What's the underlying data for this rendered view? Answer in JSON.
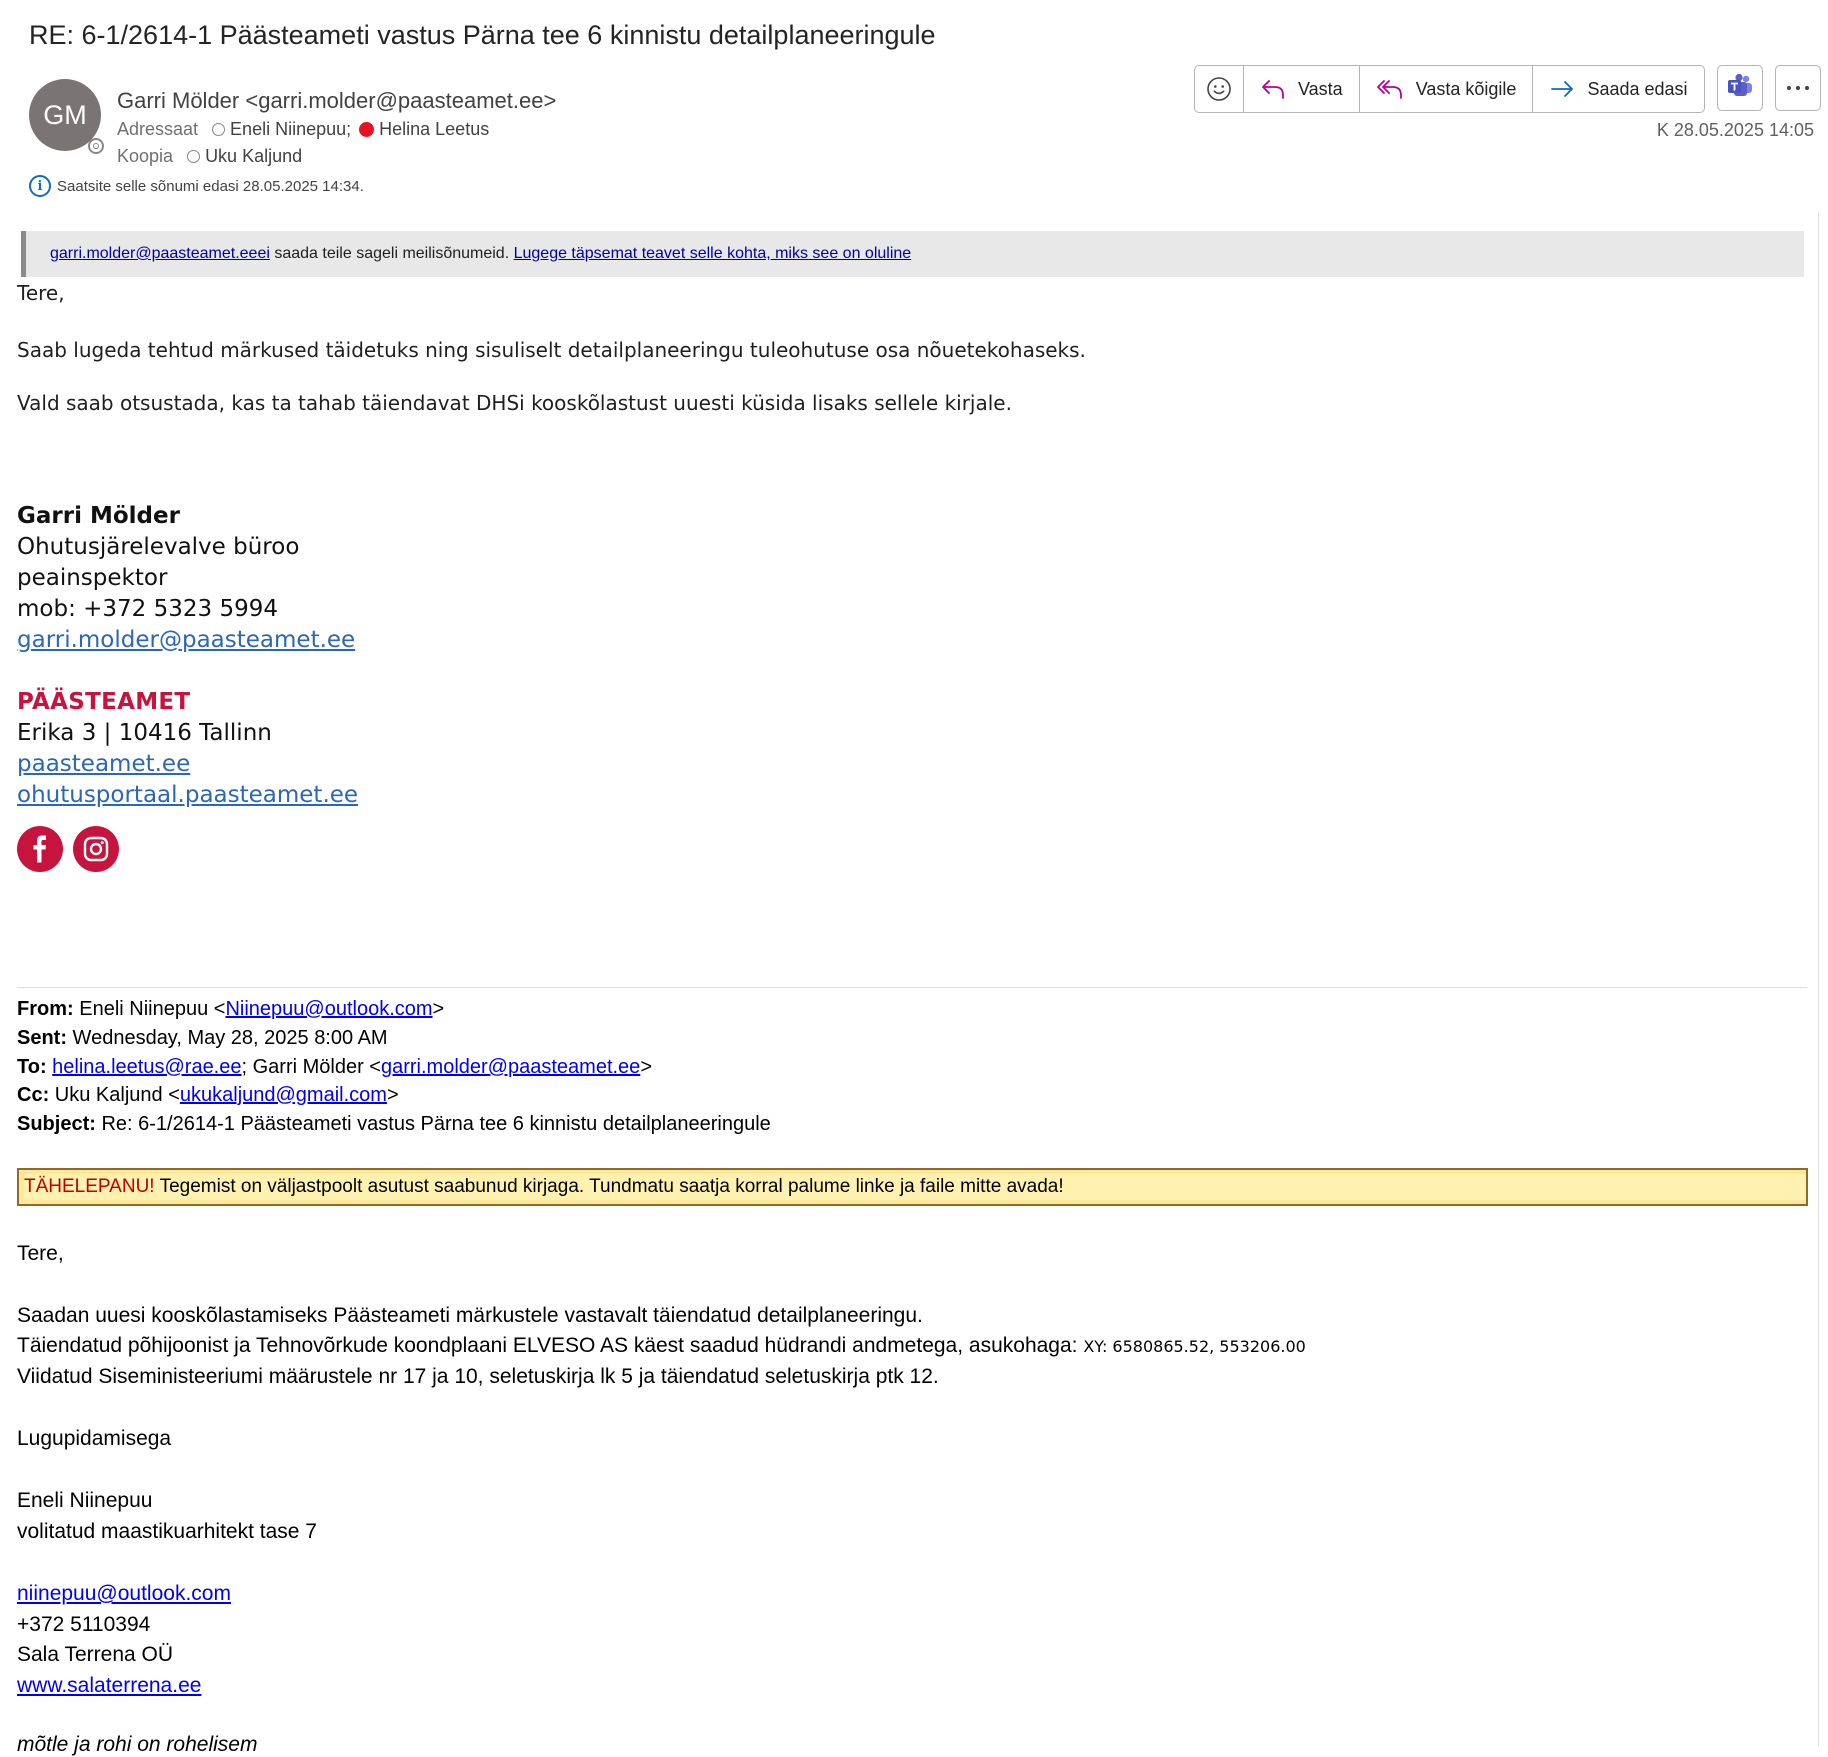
{
  "email": {
    "subject": "RE: 6-1/2614-1 Päästeameti vastus Pärna tee 6 kinnistu detailplaneeringule",
    "sender_initials": "GM",
    "sender": "Garri Mölder <garri.molder@paasteamet.ee>",
    "to_label": "Adressaat",
    "to": [
      "Eneli Niinepuu;",
      "Helina Leetus"
    ],
    "cc_label": "Koopia",
    "cc": [
      "Uku Kaljund"
    ],
    "info_text": "Saatsite selle sõnumi edasi 28.05.2025 14:34.",
    "date": "K 28.05.2025 14:05"
  },
  "toolbar": {
    "reply_label": "Vasta",
    "reply_all_label": "Vasta kõigile",
    "forward_label": "Saada edasi"
  },
  "colors": {
    "accent_reply": "#b4009e",
    "accent_forward": "#0f6cbd",
    "brand_red": "#c7143e",
    "teams": "#5b5fc7",
    "warning_bg": "#ffe89a"
  },
  "external_banner": {
    "sender_link": "garri.molder@paasteamet.eeei",
    "text": " saada teile sageli meilisõnumeid. ",
    "learn_link": "Lugege täpsemat teavet selle kohta, miks see on oluline"
  },
  "reply": {
    "greeting": "Tere,",
    "para1": "Saab lugeda tehtud märkused täidetuks ning sisuliselt detailplaneeringu tuleohutuse osa nõuetekohaseks.",
    "para2": "Vald saab otsustada, kas ta tahab täiendavat DHSi kooskõlastust uuesti küsida lisaks sellele kirjale."
  },
  "signature": {
    "name": "Garri Mölder",
    "dept": "Ohutusjärelevalve büroo",
    "title": "peainspektor",
    "mobile": "mob: +372 5323 5994",
    "email": "garri.molder@paasteamet.ee",
    "org": "PÄÄSTEAMET",
    "address": "Erika 3 | 10416 Tallinn",
    "web1": "paasteamet.ee",
    "web2": "ohutusportaal.paasteamet.ee",
    "social": [
      "facebook-icon",
      "instagram-icon"
    ]
  },
  "quoted_header": {
    "from_label": "From:",
    "from_name": " Eneli Niinepuu <",
    "from_email": "Niinepuu@outlook.com",
    "from_end": ">",
    "sent_label": "Sent:",
    "sent": " Wednesday, May 28, 2025 8:00 AM",
    "to_label": "To:",
    "to_email1": "helina.leetus@rae.ee",
    "to_mid": "; Garri Mölder <",
    "to_email2": "garri.molder@paasteamet.ee",
    "to_end": ">",
    "cc_label": "Cc:",
    "cc_name": " Uku Kaljund <",
    "cc_email": "ukukaljund@gmail.com",
    "cc_end": ">",
    "subject_label": "Subject:",
    "subject": " Re: 6-1/2614-1 Päästeameti vastus Pärna tee 6 kinnistu detailplaneeringule"
  },
  "warning": {
    "label": "TÄHELEPANU!",
    "text": "Tegemist on väljastpoolt asutust saabunud kirjaga. Tundmatu saatja korral palume linke ja faile mitte avada!"
  },
  "quoted_body": {
    "greeting": "Tere,",
    "line1": "Saadan uuesi kooskõlastamiseks Päästeameti märkustele vastavalt täiendatud detailplaneeringu.",
    "line2": "Täiendatud põhijoonist ja Tehnovõrkude koondplaani ELVESO AS käest saadud hüdrandi andmetega, asukohaga: ",
    "line2_coord": "XY: 6580865.52, 553206.00",
    "line3": "Viidatud Siseministeeriumi määrustele nr 17 ja 10, seletuskirja lk 5 ja täiendatud seletuskirja ptk 12.",
    "closing": "Lugupidamisega",
    "name": "Eneli Niinepuu",
    "title": "volitatud maastikuarhitekt tase 7",
    "email": "niinepuu@outlook.com",
    "phone": "+372 5110394",
    "company": "Sala Terrena OÜ",
    "web": "www.salaterrena.ee",
    "motto": "mõtle ja rohi on rohelisem"
  }
}
